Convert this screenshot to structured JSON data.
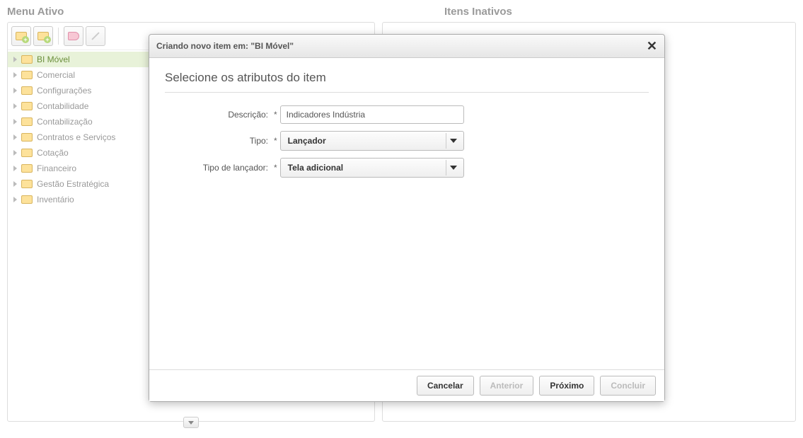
{
  "headers": {
    "menu_ativo": "Menu Ativo",
    "itens_inativos": "Itens Inativos"
  },
  "toolbar": {
    "new_folder_a": "new-folder-a",
    "new_folder_b": "new-folder-b",
    "tag": "tag",
    "edit": "edit"
  },
  "tree": {
    "items": [
      {
        "label": "BI Móvel",
        "selected": true
      },
      {
        "label": "Comercial",
        "selected": false
      },
      {
        "label": "Configurações",
        "selected": false
      },
      {
        "label": "Contabilidade",
        "selected": false
      },
      {
        "label": "Contabilização",
        "selected": false
      },
      {
        "label": "Contratos e Serviços",
        "selected": false
      },
      {
        "label": "Cotação",
        "selected": false
      },
      {
        "label": "Financeiro",
        "selected": false
      },
      {
        "label": "Gestão Estratégica",
        "selected": false
      },
      {
        "label": "Inventário",
        "selected": false
      }
    ]
  },
  "dialog": {
    "title": "Criando novo item em: \"BI Móvel\"",
    "heading": "Selecione os atributos do item",
    "required_mark": "*",
    "fields": {
      "descricao_label": "Descrição:",
      "descricao_value": "Indicadores Indústria",
      "tipo_label": "Tipo:",
      "tipo_value": "Lançador",
      "tipo_lancador_label": "Tipo de lançador:",
      "tipo_lancador_value": "Tela adicional"
    },
    "buttons": {
      "cancelar": "Cancelar",
      "anterior": "Anterior",
      "proximo": "Próximo",
      "concluir": "Concluir"
    }
  }
}
